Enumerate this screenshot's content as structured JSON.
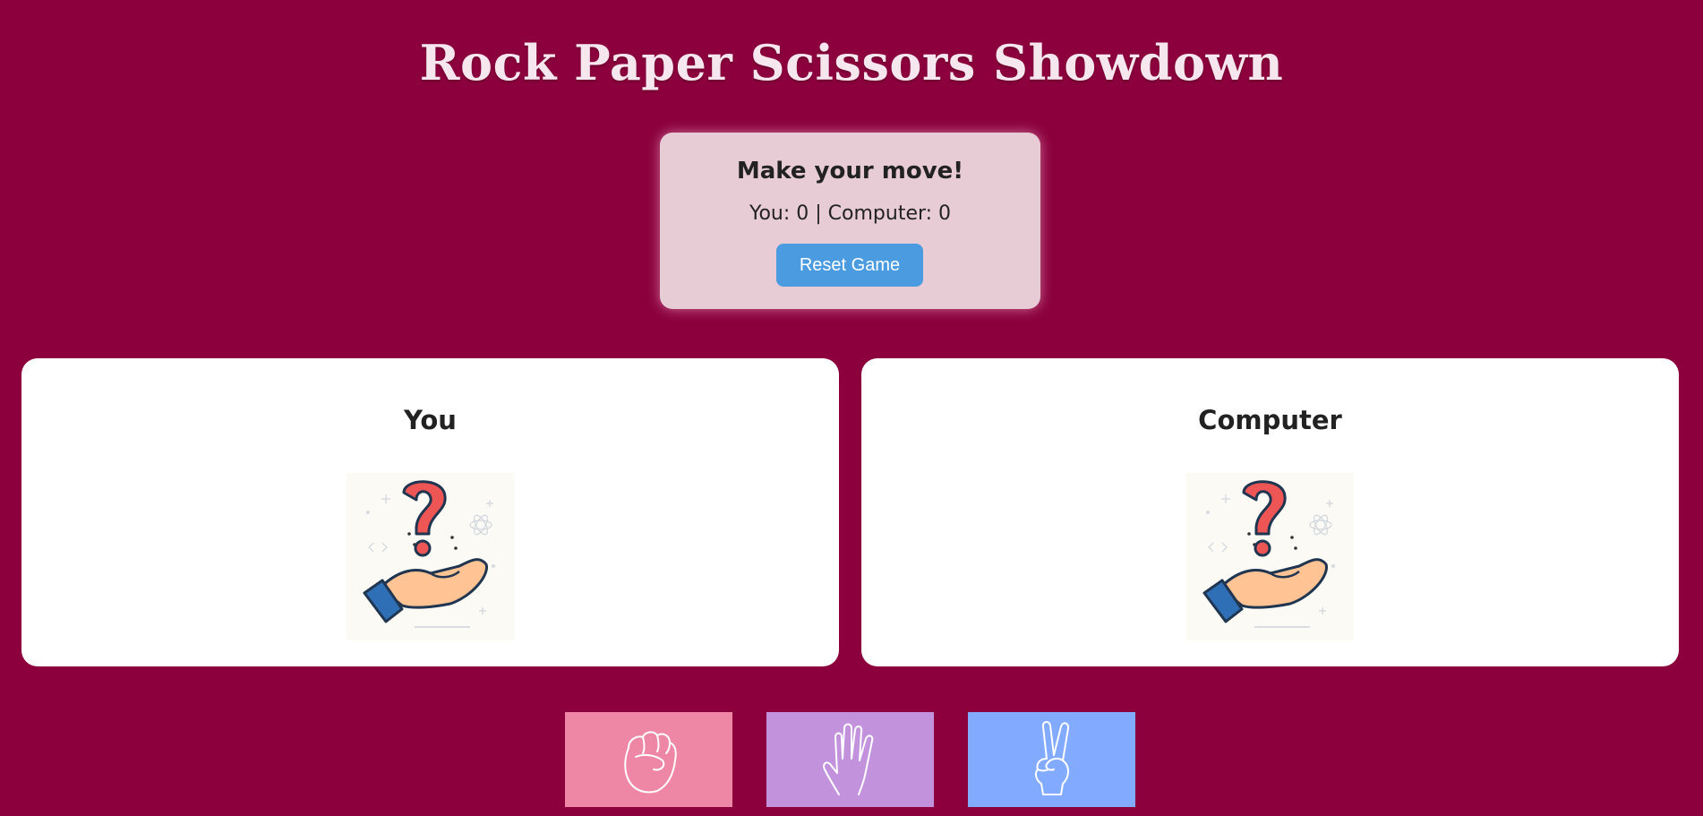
{
  "game": {
    "title": "Rock Paper Scissors Showdown"
  },
  "status": {
    "message": "Make your move!",
    "score_text": "You: 0 | Computer: 0",
    "reset_label": "Reset Game",
    "you_score": 0,
    "computer_score": 0
  },
  "players": {
    "you_label": "You",
    "computer_label": "Computer",
    "you_choice_icon": "question-hand-icon",
    "computer_choice_icon": "question-hand-icon"
  },
  "moves": [
    {
      "name": "rock",
      "icon": "fist-icon",
      "color": "#ee86a6"
    },
    {
      "name": "paper",
      "icon": "open-hand-icon",
      "color": "#c292dd"
    },
    {
      "name": "scissors",
      "icon": "peace-hand-icon",
      "color": "#82aaff"
    }
  ],
  "colors": {
    "background": "#8b003d",
    "status_card": "#e7ccd6",
    "reset_button": "#4a9be0",
    "title_text": "#f6e6ee"
  }
}
